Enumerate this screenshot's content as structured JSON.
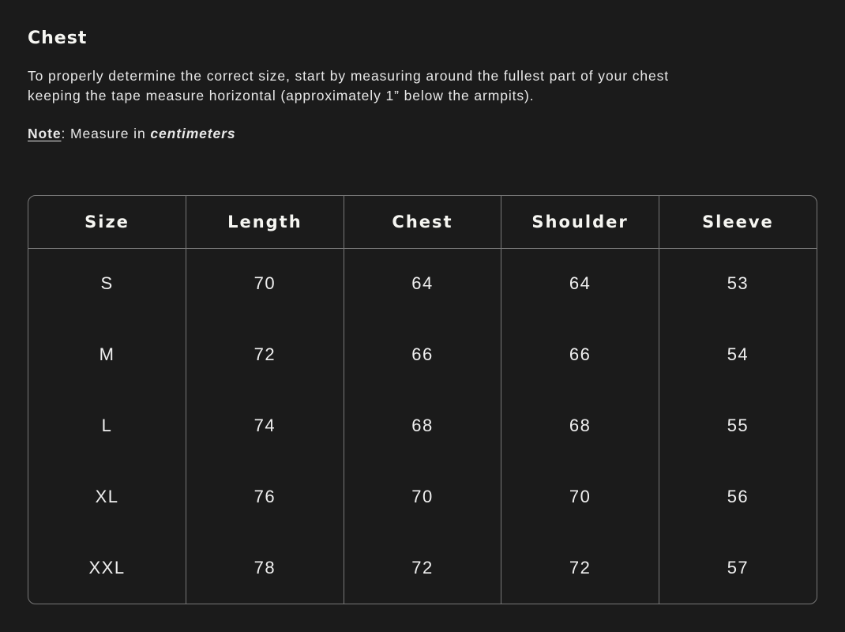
{
  "section": {
    "title": "Chest",
    "description": "To properly determine the correct size, start by measuring around the fullest part of your chest keeping the tape measure horizontal (approximately 1” below the armpits).",
    "note_label": "Note",
    "note_text": ": Measure in ",
    "note_unit": "centimeters"
  },
  "table": {
    "columns": [
      "Size",
      "Length",
      "Chest",
      "Shoulder",
      "Sleeve"
    ],
    "rows": [
      [
        "S",
        "70",
        "64",
        "64",
        "53"
      ],
      [
        "M",
        "72",
        "66",
        "66",
        "54"
      ],
      [
        "L",
        "74",
        "68",
        "68",
        "55"
      ],
      [
        "XL",
        "76",
        "70",
        "70",
        "56"
      ],
      [
        "XXL",
        "78",
        "72",
        "72",
        "57"
      ]
    ]
  }
}
